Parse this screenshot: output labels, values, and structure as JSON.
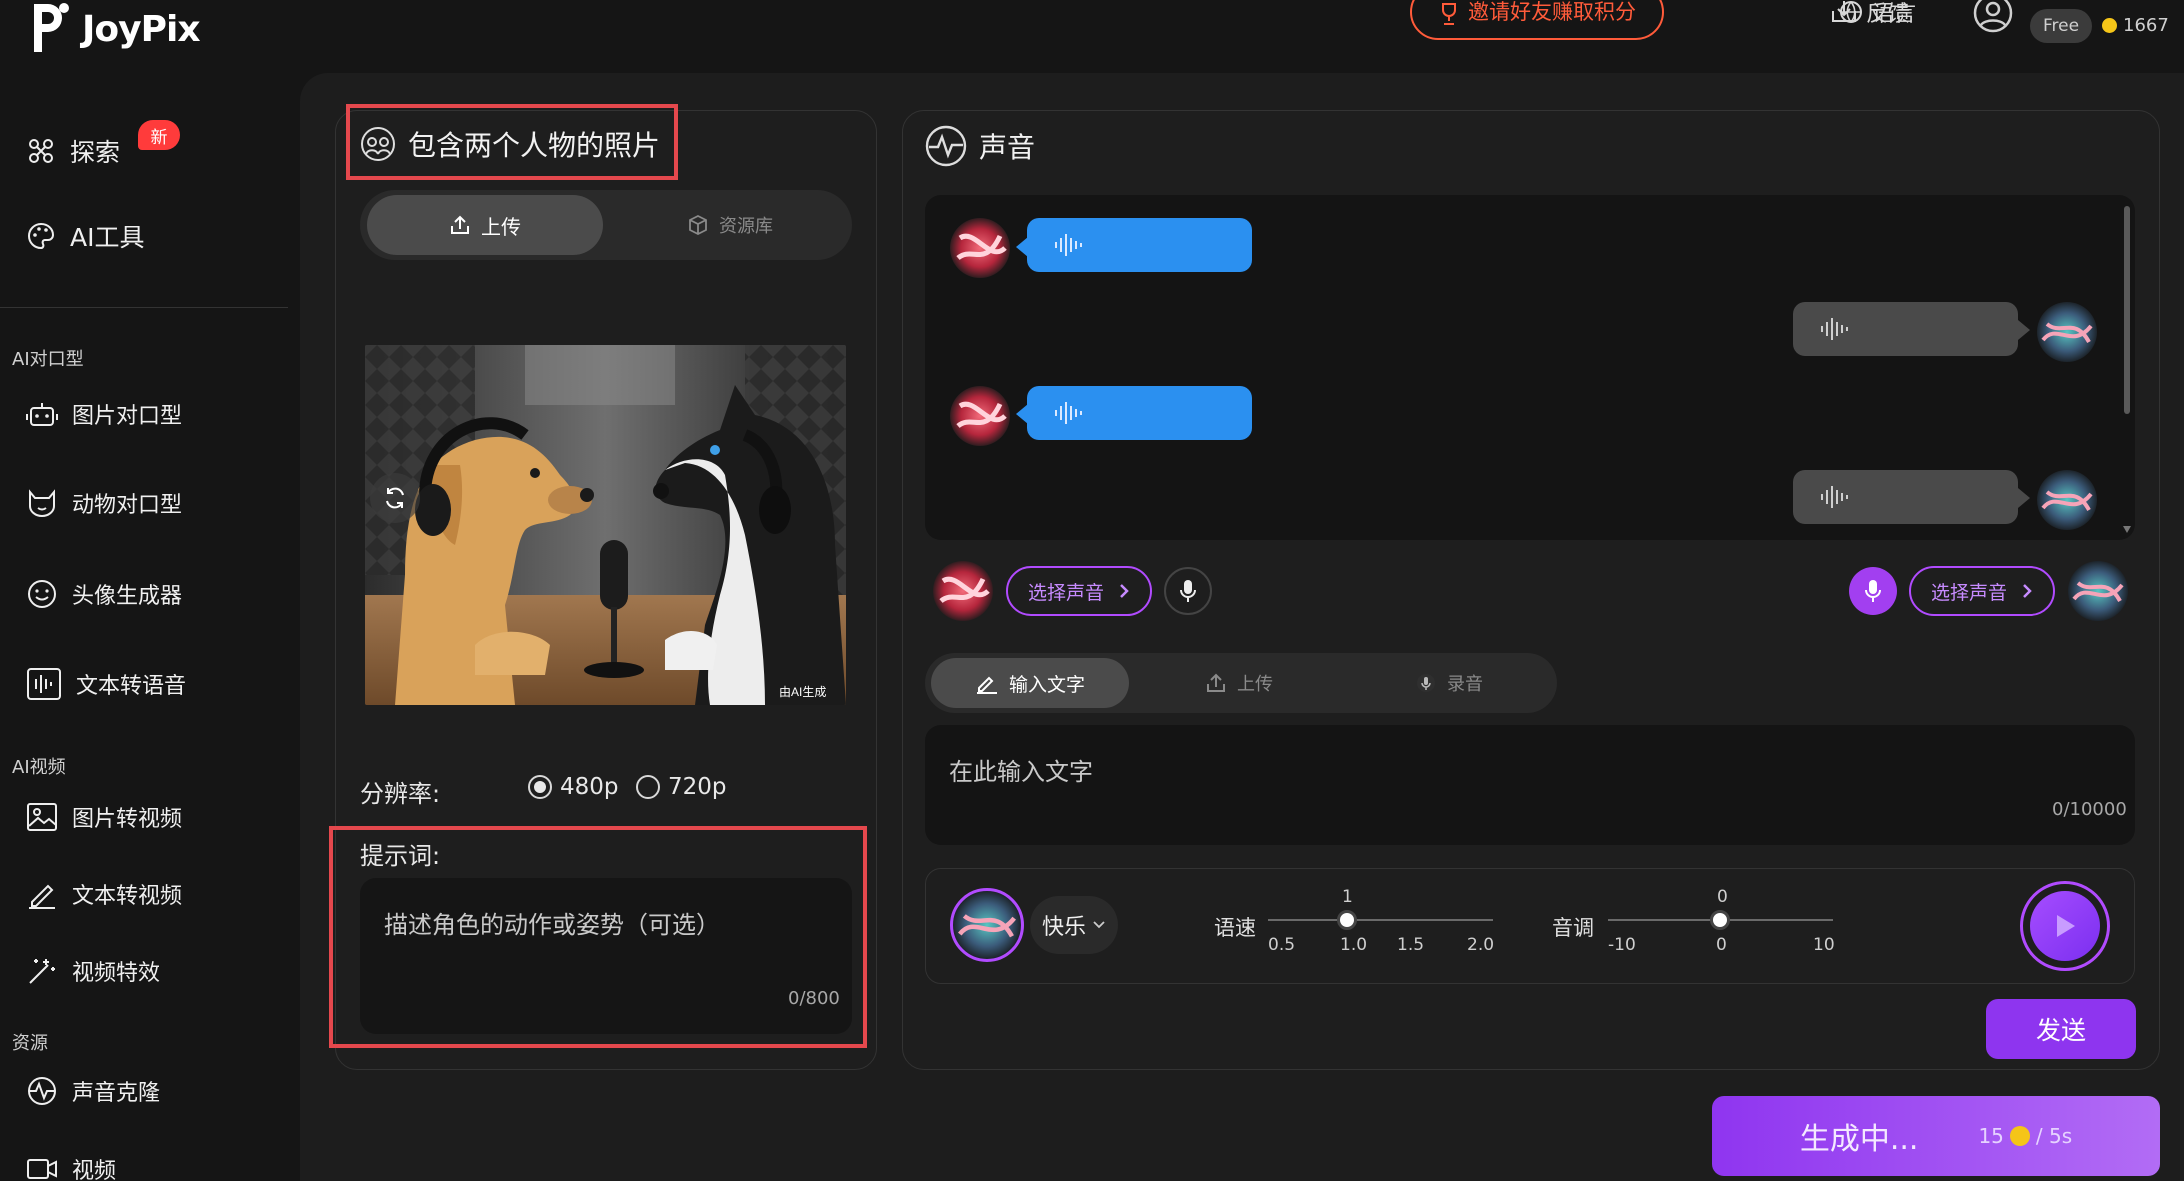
{
  "app": {
    "logo_text": "JoyPix"
  },
  "header": {
    "invite_label": "邀请好友赚取积分",
    "feedback_label": "反馈",
    "language_label": "语言",
    "plan_badge": "Free",
    "credits": "1667"
  },
  "sidebar": {
    "explore_label": "探索",
    "new_badge": "新",
    "ai_tools_label": "AI工具",
    "section_lipsync": "AI对口型",
    "photo_lipsync": "图片对口型",
    "animal_lipsync": "动物对口型",
    "avatar_generator": "头像生成器",
    "text_to_speech": "文本转语音",
    "section_video": "AI视频",
    "image_to_video": "图片转视频",
    "text_to_video": "文本转视频",
    "video_effects": "视频特效",
    "section_resources": "资源",
    "voice_clone": "声音克隆",
    "video_label": "视频"
  },
  "photo_panel": {
    "title": "包含两个人物的照片",
    "tab_upload": "上传",
    "tab_library": "资源库",
    "watermark": "由AI生成",
    "resolution_label": "分辨率:",
    "resolution_options": [
      "480p",
      "720p"
    ],
    "resolution_selected": "480p",
    "prompt_label": "提示词:",
    "prompt_placeholder": "描述角色的动作或姿势（可选）",
    "prompt_counter": "0/800"
  },
  "voice_panel": {
    "title": "声音",
    "select_voice_left": "选择声音",
    "select_voice_right": "选择声音",
    "tab_text": "输入文字",
    "tab_upload": "上传",
    "tab_record": "录音",
    "text_placeholder": "在此输入文字",
    "text_counter": "0/10000",
    "emotion_value": "快乐",
    "speed_label": "语速",
    "speed_value": "1",
    "speed_value_num": 1.0,
    "speed_ticks": [
      "0.5",
      "1.0",
      "1.5",
      "2.0"
    ],
    "pitch_label": "音调",
    "pitch_value": "0",
    "pitch_value_num": 0,
    "pitch_ticks": [
      "-10",
      "0",
      "10"
    ],
    "send_label": "发送"
  },
  "generate": {
    "label": "生成中...",
    "cost": "15",
    "duration": "/ 5s"
  },
  "colors": {
    "accent_purple": "#8e35ef",
    "highlight_red": "#e5484d",
    "bubble_blue": "#2b90f0",
    "bubble_gray": "#4a4a4a",
    "invite_orange": "#ff5b3a"
  }
}
